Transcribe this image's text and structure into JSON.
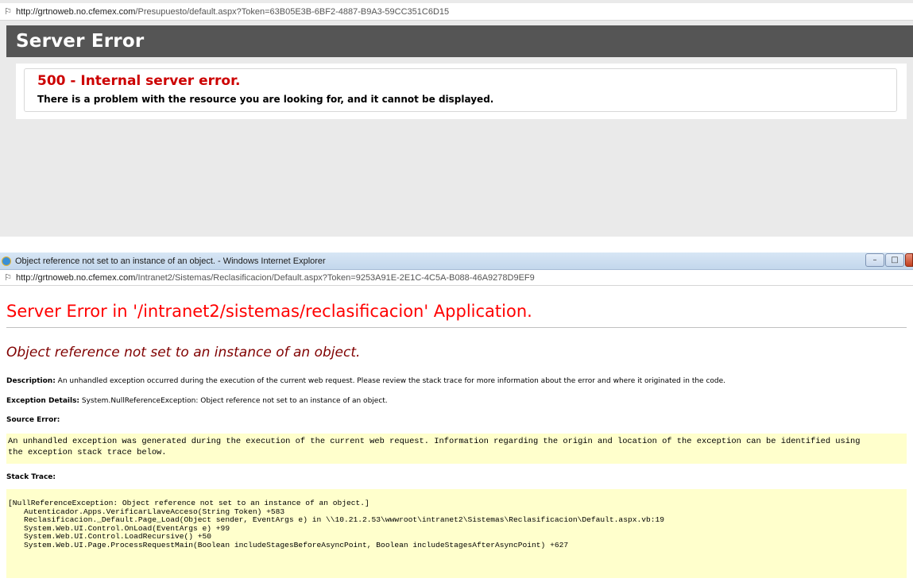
{
  "top_window": {
    "address_bar": {
      "url_host": "http://grtnoweb.no.cfemex.com",
      "url_path": "/Presupuesto/default.aspx?Token=63B05E3B-6BF2-4887-B9A3-59CC351C6D15"
    },
    "header_title": "Server Error",
    "error_code": "500 - Internal server error.",
    "error_message": "There is a problem with the resource you are looking for, and it cannot be displayed."
  },
  "bottom_window": {
    "window_title": "Object reference not set to an instance of an object. - Windows Internet Explorer",
    "controls": {
      "minimize": "–",
      "maximize": "□",
      "close": ""
    },
    "address_bar": {
      "url_host": "http://grtnoweb.no.cfemex.com",
      "url_path": "/Intranet2/Sistemas/Reclasificacion/Default.aspx?Token=9253A91E-2E1C-4C5A-B088-46A9278D9EF9"
    },
    "page_title": "Server Error in '/intranet2/sistemas/reclasificacion' Application.",
    "subtitle": "Object reference not set to an instance of an object.",
    "description_label": "Description:",
    "description_text": " An unhandled exception occurred during the execution of the current web request. Please review the stack trace for more information about the error and where it originated in the code.",
    "exception_label": "Exception Details:",
    "exception_text": " System.NullReferenceException: Object reference not set to an instance of an object.",
    "source_error_label": "Source Error:",
    "source_error_lines": [
      "An unhandled exception was generated during the execution of the current web request. Information regarding the origin and location of the exception can be identified using",
      "the exception stack trace below."
    ],
    "stack_trace_label": "Stack Trace:",
    "stack_trace_lines": [
      "[NullReferenceException: Object reference not set to an instance of an object.]",
      "Autenticador.Apps.VerificarLlaveAcceso(String Token) +583",
      "Reclasificacion._Default.Page_Load(Object sender, EventArgs e) in \\\\10.21.2.53\\wwwroot\\intranet2\\Sistemas\\Reclasificacion\\Default.aspx.vb:19",
      "System.Web.UI.Control.OnLoad(EventArgs e) +99",
      "System.Web.UI.Control.LoadRecursive() +50",
      "System.Web.UI.Page.ProcessRequestMain(Boolean includeStagesBeforeAsyncPoint, Boolean includeStagesAfterAsyncPoint) +627"
    ]
  },
  "colors": {
    "header_bg": "#555555",
    "error_red": "#cc0000",
    "ysod_title_red": "#ff0000",
    "ysod_subtitle_maroon": "#800000",
    "code_bg": "#ffffcc"
  }
}
